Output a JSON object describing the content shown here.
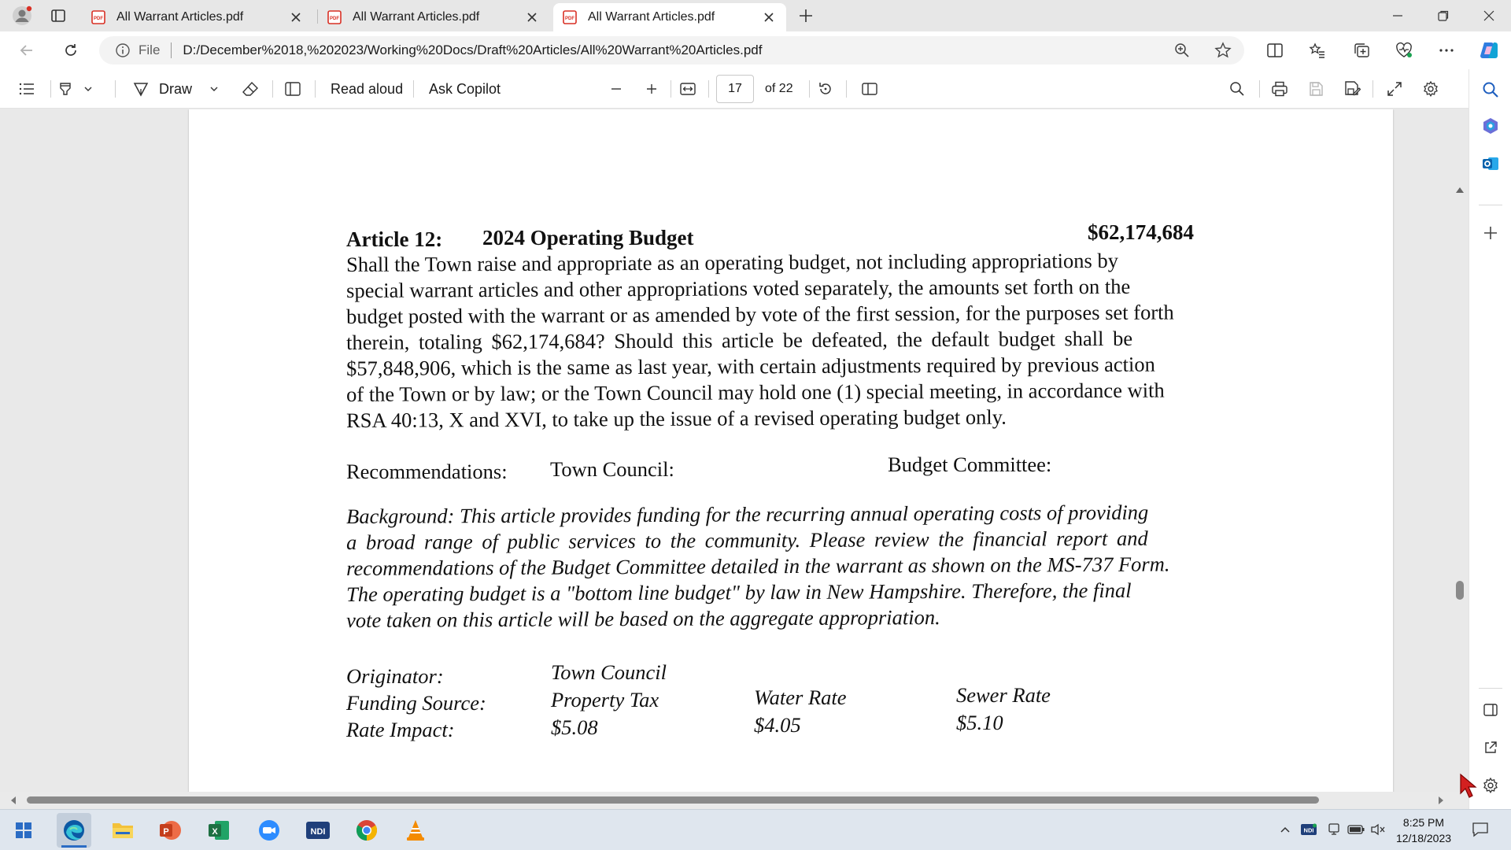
{
  "browser": {
    "tabs": [
      {
        "title": "All Warrant Articles.pdf",
        "active": false
      },
      {
        "title": "All Warrant Articles.pdf",
        "active": false
      },
      {
        "title": "All Warrant Articles.pdf",
        "active": true
      }
    ],
    "address": {
      "scheme_label": "File",
      "url": "D:/December%2018,%202023/Working%20Docs/Draft%20Articles/All%20Warrant%20Articles.pdf"
    }
  },
  "pdf_toolbar": {
    "draw_label": "Draw",
    "read_aloud_label": "Read aloud",
    "ask_copilot_label": "Ask Copilot",
    "page_current": "17",
    "page_total": "of 22"
  },
  "document": {
    "article_label": "Article 12:",
    "article_title": "2024 Operating Budget",
    "article_amount": "$62,174,684",
    "body_lines": [
      "Shall the Town raise and appropriate as an operating budget, not including appropriations by",
      "special warrant articles and other appropriations voted separately, the amounts set forth on the",
      "budget posted with the warrant or as amended by vote of the first session, for the purposes set forth",
      "therein, totaling $62,174,684? Should this article be defeated, the default budget shall be",
      "$57,848,906, which is the same as last year, with certain adjustments required by previous action",
      "of the Town or by law; or the Town Council may hold one (1) special meeting, in accordance with",
      "RSA 40:13, X and XVI, to take up the issue of a revised operating budget only."
    ],
    "recommendations_label": "Recommendations:",
    "town_council_label": "Town Council:",
    "budget_committee_label": "Budget Committee:",
    "background_lines": [
      "Background:  This article provides funding for the recurring annual operating costs of providing",
      "a broad range of public services to the community. Please review the financial report and",
      "recommendations of the Budget Committee detailed in the warrant as shown on the MS-737 Form.",
      "The operating budget is a \"bottom line budget\" by law in New Hampshire. Therefore, the final",
      "vote taken on this article will be based on the aggregate appropriation."
    ],
    "originator_label": "Originator:",
    "originator_value": "Town Council",
    "funding_source_label": "Funding Source:",
    "funding_sources": [
      "Property Tax",
      "Water Rate",
      "Sewer Rate"
    ],
    "rate_impact_label": "Rate Impact:",
    "rate_impacts": [
      "$5.08",
      "$4.05",
      "$5.10"
    ]
  },
  "taskbar": {
    "time": "8:25 PM",
    "date": "12/18/2023"
  },
  "colors": {
    "edge_blue": "#0c59a4",
    "excel_green": "#1d6f42",
    "powerpoint_orange": "#c43e1c",
    "zoom_blue": "#2d8cff",
    "pdf_red": "#d93025"
  }
}
